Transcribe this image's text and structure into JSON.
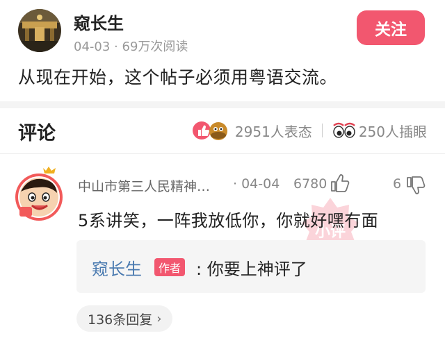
{
  "post": {
    "author": "窥长生",
    "date": "04-03",
    "meta_separator": "·",
    "views": "69万次阅读",
    "follow_label": "关注",
    "body": "从现在开始，这个帖子必须用粤语交流。"
  },
  "comments_section": {
    "title": "评论",
    "reactions_count": "2951人表态",
    "eyes_count": "250人插眼"
  },
  "comment": {
    "user": "中山市第三人民精神…",
    "date_prefix": "·",
    "date": "04-04",
    "likes": "6780",
    "dislikes": "6",
    "text": "5系讲笑，一阵我放低你，你就好嘿冇面",
    "stamp_text": "小评"
  },
  "reply": {
    "author": "窥长生",
    "author_tag": "作者",
    "text": ": 你要上神评了"
  },
  "more_replies": {
    "label": "136条回复",
    "chevron": "›"
  },
  "colors": {
    "accent": "#f2576f",
    "reply_author": "#4a7ab0",
    "muted": "#999999"
  }
}
